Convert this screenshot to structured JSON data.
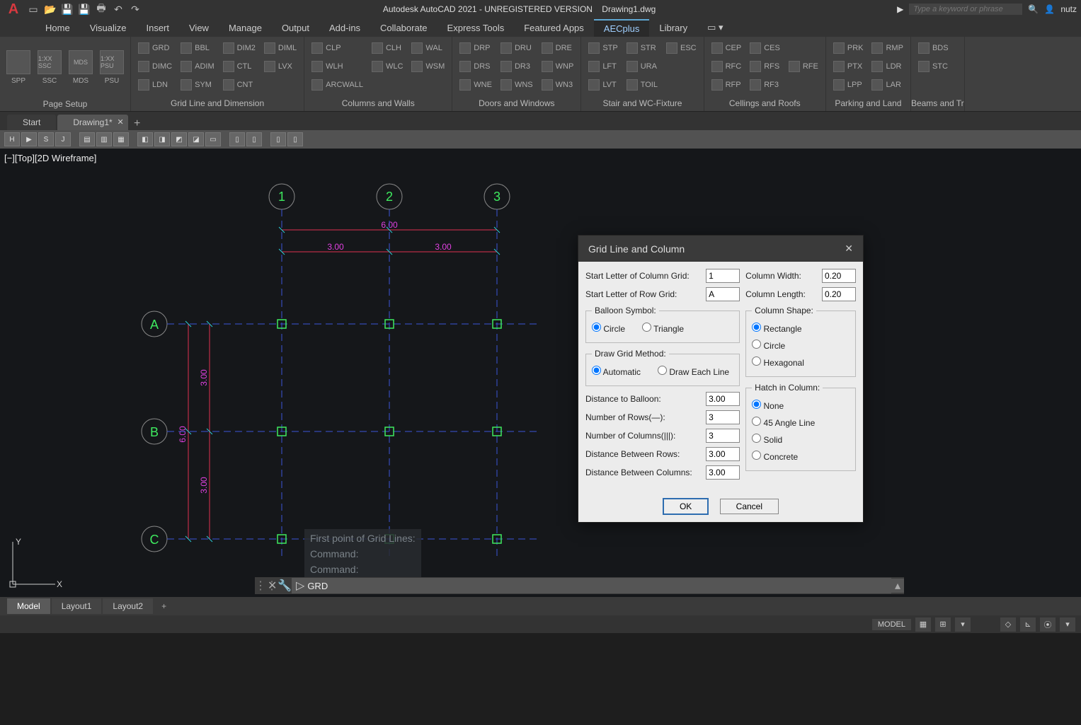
{
  "title": {
    "app": "Autodesk AutoCAD 2021 - UNREGISTERED VERSION",
    "file": "Drawing1.dwg"
  },
  "search_placeholder": "Type a keyword or phrase",
  "user": "nutz",
  "menu": [
    "Home",
    "Visualize",
    "Insert",
    "View",
    "Manage",
    "Output",
    "Add-ins",
    "Collaborate",
    "Express Tools",
    "Featured Apps",
    "AECplus",
    "Library"
  ],
  "menu_active": "AECplus",
  "ribbon": {
    "panels": [
      {
        "title": "Page Setup",
        "large": [
          "SPP",
          "SSC",
          "MDS",
          "PSU"
        ],
        "large_extra": [
          "",
          "1:XX\nSSC",
          "MDS",
          "1:XX\nPSU"
        ]
      },
      {
        "title": "Grid Line and Dimension",
        "cols": [
          [
            "GRD",
            "DIMC",
            "LDN"
          ],
          [
            "BBL",
            "ADIM",
            "SYM"
          ],
          [
            "DIM2",
            "CTL",
            "CNT"
          ],
          [
            "DIML",
            "LVX",
            ""
          ]
        ]
      },
      {
        "title": "Columns and Walls",
        "cols": [
          [
            "CLP",
            "WLH",
            "ARCWALL"
          ],
          [
            "CLH",
            "WLC",
            ""
          ],
          [
            "WAL",
            "WSM",
            ""
          ]
        ]
      },
      {
        "title": "Doors and Windows",
        "cols": [
          [
            "DRP",
            "DRS",
            "WNE"
          ],
          [
            "DRU",
            "DR3",
            "WNS"
          ],
          [
            "DRE",
            "WNP",
            "WN3"
          ]
        ]
      },
      {
        "title": "Stair and WC-Fixture",
        "cols": [
          [
            "STP",
            "LFT",
            "LVT"
          ],
          [
            "STR",
            "URA",
            "TOIL"
          ],
          [
            "ESC",
            "",
            ""
          ]
        ]
      },
      {
        "title": "Cellings and Roofs",
        "cols": [
          [
            "CEP",
            "RFC",
            "RFP"
          ],
          [
            "CES",
            "RFS",
            "RF3"
          ],
          [
            "",
            "RFE",
            ""
          ]
        ]
      },
      {
        "title": "Parking and Land",
        "cols": [
          [
            "PRK",
            "PTX",
            "LPP"
          ],
          [
            "RMP",
            "LDR",
            "LAR"
          ]
        ]
      },
      {
        "title": "Beams and Tr",
        "cols": [
          [
            "BDS",
            "STC"
          ]
        ]
      }
    ]
  },
  "filetabs": [
    {
      "label": "Start"
    },
    {
      "label": "Drawing1*",
      "active": true,
      "closable": true
    }
  ],
  "viewport_label": "[−][Top][2D Wireframe]",
  "chart_data": {
    "type": "diagram",
    "column_labels": [
      "1",
      "2",
      "3"
    ],
    "row_labels": [
      "A",
      "B",
      "C"
    ],
    "dim_top_total": "6.00",
    "dim_top_segments": [
      "3.00",
      "3.00"
    ],
    "dim_left_total": "6.00",
    "dim_left_segments": [
      "3.00",
      "3.00"
    ]
  },
  "cmd_history": [
    "First point of Grid Lines:",
    "Command:",
    "Command:"
  ],
  "cmd_input": "GRD",
  "layouts": [
    "Model",
    "Layout1",
    "Layout2"
  ],
  "layout_active": "Model",
  "status_model": "MODEL",
  "dialog": {
    "title": "Grid Line and Column",
    "start_col_label": "Start Letter of Column Grid:",
    "start_col_value": "1",
    "start_row_label": "Start Letter of Row Grid:",
    "start_row_value": "A",
    "balloon_legend": "Balloon Symbol:",
    "balloon_opts": [
      "Circle",
      "Triangle"
    ],
    "balloon_sel": "Circle",
    "method_legend": "Draw Grid Method:",
    "method_opts": [
      "Automatic",
      "Draw Each Line"
    ],
    "method_sel": "Automatic",
    "dist_balloon_label": "Distance to Balloon:",
    "dist_balloon_value": "3.00",
    "num_rows_label": "Number of Rows(—):",
    "num_rows_value": "3",
    "num_cols_label": "Number of Columns(|||):",
    "num_cols_value": "3",
    "dist_rows_label": "Distance Between Rows:",
    "dist_rows_value": "3.00",
    "dist_cols_label": "Distance Between Columns:",
    "dist_cols_value": "3.00",
    "col_width_label": "Column Width:",
    "col_width_value": "0.20",
    "col_length_label": "Column Length:",
    "col_length_value": "0.20",
    "shape_legend": "Column Shape:",
    "shape_opts": [
      "Rectangle",
      "Circle",
      "Hexagonal"
    ],
    "shape_sel": "Rectangle",
    "hatch_legend": "Hatch in Column:",
    "hatch_opts": [
      "None",
      "45 Angle Line",
      "Solid",
      "Concrete"
    ],
    "hatch_sel": "None",
    "ok": "OK",
    "cancel": "Cancel"
  }
}
